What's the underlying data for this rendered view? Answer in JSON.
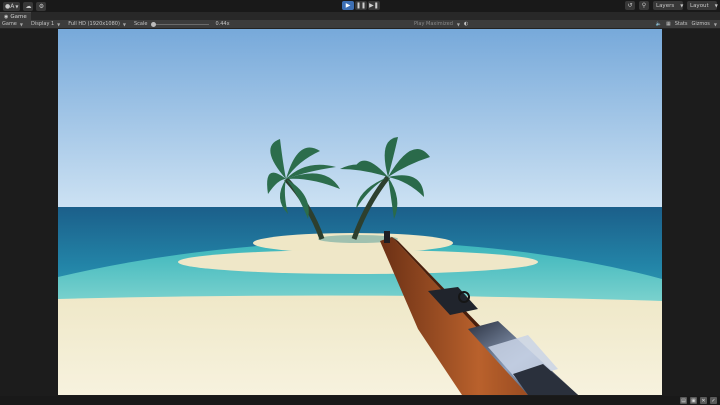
{
  "toolbar": {
    "account_label": "A",
    "cloud_icon": "cloud-icon",
    "collab_icon": "collab-icon",
    "play_controls": [
      "play-icon",
      "pause-icon",
      "step-icon"
    ],
    "history_icon": "history-icon",
    "search_icon": "search-icon",
    "layers_label": "Layers",
    "layout_label": "Layout"
  },
  "tab": {
    "label": "Game",
    "icon": "gamepad-icon"
  },
  "game_controls": {
    "mode_label": "Game",
    "display_label": "Display 1",
    "resolution_label": "Full HD (1920x1080)",
    "scale_label": "Scale",
    "scale_value": "0.44x",
    "play_mode_label": "Play Maximized",
    "stats_label": "Stats",
    "gizmos_label": "Gizmos"
  },
  "colors": {
    "accent": "#3d6fb3",
    "sky_top": "#7eb0dd",
    "sky_bottom": "#c7def2",
    "sea_deep": "#1f6e9a",
    "sea_shallow": "#44c4c2",
    "sand": "#f2ecd1"
  },
  "status_icons": [
    "console-icon",
    "save-icon",
    "tools-icon",
    "settings-icon"
  ]
}
